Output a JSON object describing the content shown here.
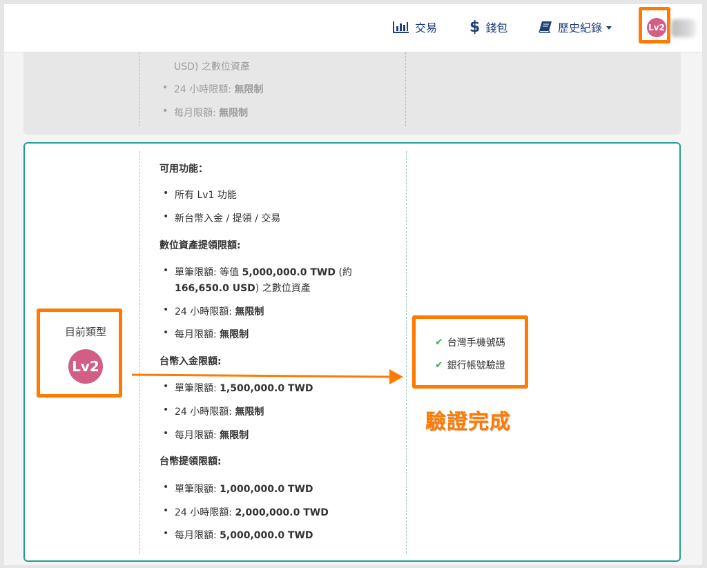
{
  "nav": {
    "trade_label": "交易",
    "wallet_label": "錢包",
    "history_label": "歷史紀錄",
    "trade_icon": "bar-chart-icon",
    "wallet_icon": "dollar-icon",
    "history_icon": "book-icon",
    "avatar_level": "Lv2"
  },
  "previous_card": {
    "line1": "USD) 之數位資產",
    "line2_label": "24 小時限額: ",
    "line2_value": "無限制",
    "line3_label": "每月限額: ",
    "line3_value": "無限制"
  },
  "current": {
    "type_label": "目前類型",
    "level_badge": "Lv2",
    "features_heading": "可用功能：",
    "features": [
      "所有 Lv1 功能",
      "新台幣入金 / 提領 / 交易"
    ],
    "crypto_withdraw_heading": "數位資產提領限額:",
    "crypto_single_label": "單筆限額: 等值 ",
    "crypto_single_value": "5,000,000.0 TWD",
    "crypto_single_suffix": " (約",
    "crypto_single_line2_value": "166,650.0 USD",
    "crypto_single_line2_suffix": ") 之數位資產",
    "crypto_daily_label": "24 小時限額: ",
    "crypto_daily_value": "無限制",
    "crypto_monthly_label": "每月限額: ",
    "crypto_monthly_value": "無限制",
    "twd_deposit_heading": "台幣入金限額:",
    "twd_deposit_single_label": "單筆限額: ",
    "twd_deposit_single_value": "1,500,000.0 TWD",
    "twd_deposit_daily_label": "24 小時限額: ",
    "twd_deposit_daily_value": "無限制",
    "twd_deposit_monthly_label": "每月限額: ",
    "twd_deposit_monthly_value": "無限制",
    "twd_withdraw_heading": "台幣提領限額:",
    "twd_withdraw_single_label": "單筆限額: ",
    "twd_withdraw_single_value": "1,000,000.0 TWD",
    "twd_withdraw_daily_label": "24 小時限額: ",
    "twd_withdraw_daily_value": "2,000,000.0 TWD",
    "twd_withdraw_monthly_label": "每月限額: ",
    "twd_withdraw_monthly_value": "5,000,000.0 TWD"
  },
  "verification": {
    "items": [
      "台灣手機號碼",
      "銀行帳號驗證"
    ],
    "check_icon": "check-icon",
    "annotation": "驗證完成"
  },
  "colors": {
    "highlight": "#ff7a00",
    "accent": "#1fa08f",
    "badge": "#d25d85",
    "nav_text": "#1f3f7a",
    "check": "#3eaa55"
  }
}
